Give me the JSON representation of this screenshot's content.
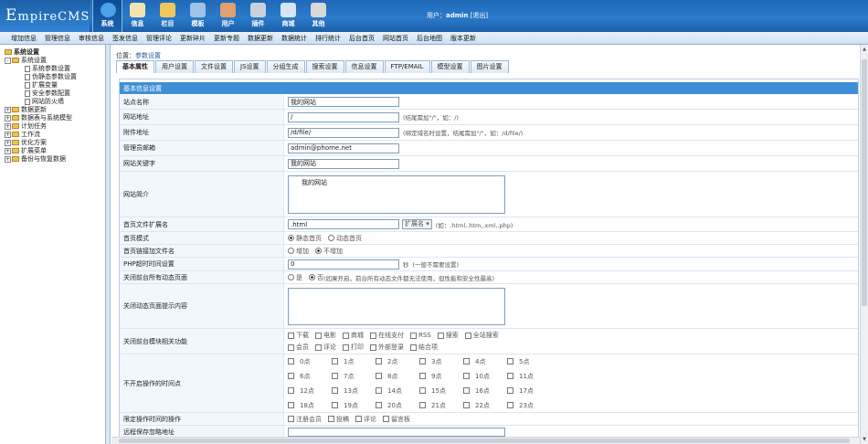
{
  "header": {
    "logo_main": "E",
    "logo_rest": "mpireCMS",
    "user_label": "用户：",
    "user_name": "admin",
    "logout": "[退出]"
  },
  "nav": [
    {
      "label": "系统",
      "icon": "globe-icon",
      "color": "#4aa3e8"
    },
    {
      "label": "信息",
      "icon": "document-icon",
      "color": "#f1e4b0"
    },
    {
      "label": "栏目",
      "icon": "folder-icon",
      "color": "#f0c75a"
    },
    {
      "label": "模板",
      "icon": "template-icon",
      "color": "#9ec3e6"
    },
    {
      "label": "用户",
      "icon": "user-icon",
      "color": "#e0a070"
    },
    {
      "label": "插件",
      "icon": "plugin-icon",
      "color": "#c8d0db"
    },
    {
      "label": "商城",
      "icon": "mail-icon",
      "color": "#d7e4f3"
    },
    {
      "label": "其他",
      "icon": "gear-icon",
      "color": "#d8d8d8"
    }
  ],
  "subnav": [
    "增加信息",
    "管理信息",
    "审核信息",
    "签发信息",
    "管理评论",
    "更新碎片",
    "更新专题",
    "数据更新",
    "数据统计",
    "排行统计",
    "后台首页",
    "网站首页",
    "后台地图",
    "版本更新"
  ],
  "sidebar": {
    "root": "系统设置",
    "group": "系统设置",
    "children": [
      "系统参数设置",
      "伪静态参数设置",
      "扩展变量",
      "安全参数配置",
      "网站防火墙"
    ],
    "others": [
      "数据更新",
      "数据表与系统模型",
      "计划任务",
      "工作流",
      "优化方案",
      "扩展菜单",
      "备份与恢复数据"
    ]
  },
  "breadcrumb": {
    "prefix": "位置：",
    "link": "参数设置"
  },
  "tabs": [
    "基本属性",
    "用户设置",
    "文件设置",
    "JS设置",
    "分组生成",
    "搜索设置",
    "信息设置",
    "FTP/EMAIL",
    "模型设置",
    "图片设置"
  ],
  "form": {
    "section": "基本信息设置",
    "site_name": {
      "label": "站点名称",
      "value": "我的网站"
    },
    "site_url": {
      "label": "网站地址",
      "value": "/",
      "hint": "(结尾需加\"/\"，如：/)"
    },
    "attach_url": {
      "label": "附件地址",
      "value": "/d/file/",
      "hint": "(绑定域名时设置，结尾需加\"/\"，如：/d/file/)"
    },
    "admin_email": {
      "label": "管理员邮箱",
      "value": "admin@phome.net"
    },
    "keywords": {
      "label": "网站关键字",
      "value": "我的网站"
    },
    "intro": {
      "label": "网站简介",
      "value": "我的网站"
    },
    "home_ext": {
      "label": "首页文件扩展名",
      "value": ".html",
      "button": "扩展名 ▾",
      "hint": "(如：.html,.htm,.xml,.php)"
    },
    "home_mode": {
      "label": "首页模式",
      "opt1": "静态首页",
      "opt2": "动态首页"
    },
    "home_suffix": {
      "label": "首页链接加文件名",
      "opt1": "增加",
      "opt2": "不增加"
    },
    "php_timeout": {
      "label": "PHP超时时间设置",
      "value": "0",
      "unit": "秒",
      "hint": "(一般不需要设置)"
    },
    "close_dynamic": {
      "label": "关闭前台所有动态页面",
      "opt1": "是",
      "opt2": "否",
      "hint": "(如果开启，前台所有动态文件都无法使用，但性能和安全性最高)"
    },
    "close_tip": {
      "label": "关闭动态页面提示内容"
    },
    "close_modules": {
      "label": "关闭前台模块相关功能",
      "row1": [
        "下载",
        "电影",
        "商城",
        "在线支付",
        "RSS",
        "搜索",
        "全站搜索"
      ],
      "row2": [
        "会员",
        "评论",
        "打印",
        "外部登录",
        "结合项"
      ]
    },
    "hours": {
      "label": "不开启操作的时间点",
      "items": [
        "0点",
        "1点",
        "2点",
        "3点",
        "4点",
        "5点",
        "6点",
        "7点",
        "8点",
        "9点",
        "10点",
        "11点",
        "12点",
        "13点",
        "14点",
        "15点",
        "16点",
        "17点",
        "18点",
        "19点",
        "20点",
        "21点",
        "22点",
        "23点"
      ]
    },
    "limit_ops": {
      "label": "限定操作时间的操作",
      "items": [
        "注册会员",
        "投稿",
        "评论",
        "留言板"
      ]
    },
    "remote_save": {
      "label": "远程保存忽略地址"
    }
  }
}
